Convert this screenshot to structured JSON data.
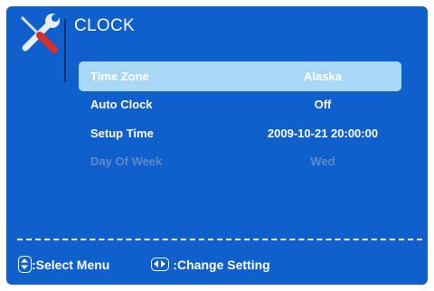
{
  "menu": {
    "title": "CLOCK",
    "icon": "tools-icon"
  },
  "rows": [
    {
      "label": "Time Zone",
      "value": "Alaska",
      "state": "selected"
    },
    {
      "label": "Auto Clock",
      "value": "Off",
      "state": "normal"
    },
    {
      "label": "Setup Time",
      "value": "2009-10-21 20:00:00",
      "state": "normal"
    },
    {
      "label": "Day Of Week",
      "value": "Wed",
      "state": "disabled"
    }
  ],
  "footer": {
    "select_label": ":Select Menu",
    "change_label": ":Change Setting",
    "select_icon": "up-down-icon",
    "change_icon": "left-right-icon"
  },
  "colors": {
    "background": "#0f5fcc",
    "highlight": "#a8d8f6",
    "text": "#ffffff",
    "disabled_text": "#5f8ac9"
  }
}
